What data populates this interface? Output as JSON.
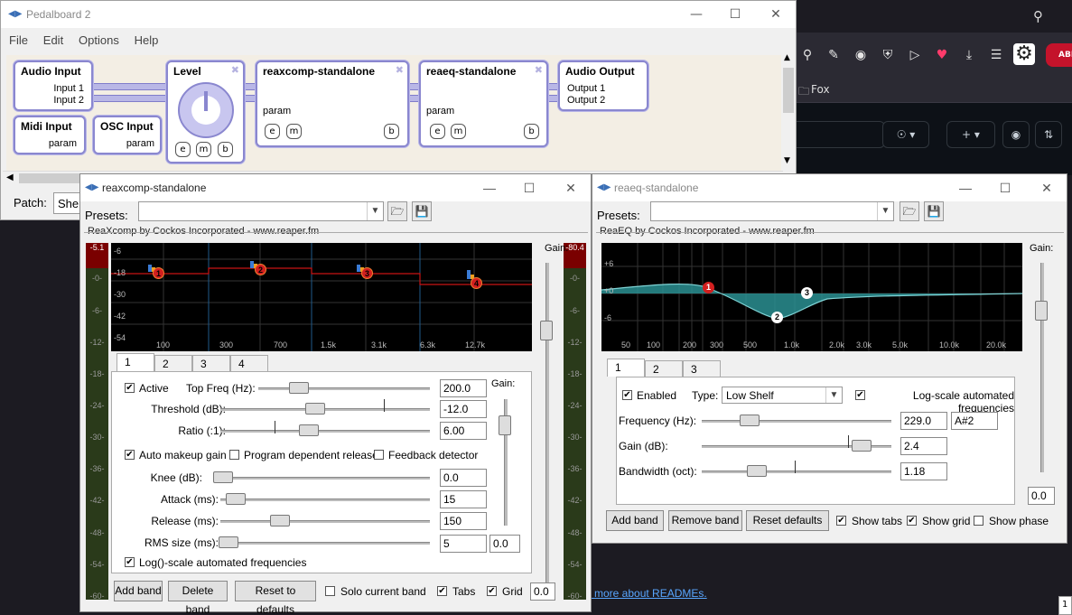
{
  "browser": {
    "bookmark_folder": "Fox",
    "readme_link": "n more about READMEs.",
    "badge_text": "ABI",
    "corner_text": "1"
  },
  "pedalboard": {
    "title": "Pedalboard 2",
    "menu": [
      "File",
      "Edit",
      "Options",
      "Help"
    ],
    "patch_label": "Patch:",
    "patch_value": "She",
    "blocks": {
      "audio_input": {
        "title": "Audio Input",
        "ports": [
          "Input 1",
          "Input 2"
        ]
      },
      "midi_input": {
        "title": "Midi Input",
        "port": "param"
      },
      "osc_input": {
        "title": "OSC Input",
        "port": "param"
      },
      "level": {
        "title": "Level",
        "btns": [
          "e",
          "m",
          "b"
        ]
      },
      "reaxcomp": {
        "title": "reaxcomp-standalone",
        "port": "param",
        "btns": [
          "e",
          "m",
          "b"
        ]
      },
      "reaeq": {
        "title": "reaeq-standalone",
        "port": "param",
        "btns": [
          "e",
          "m",
          "b"
        ]
      },
      "audio_output": {
        "title": "Audio Output",
        "ports": [
          "Output 1",
          "Output 2"
        ]
      }
    }
  },
  "reaxcomp": {
    "title": "reaxcomp-standalone",
    "presets_label": "Presets:",
    "vendor": "ReaXcomp by Cockos Incorporated - www.reaper.fm",
    "gain_label": "Gain:",
    "meter_left_top": "-5.1",
    "meter_right_top": "-80.4",
    "meter_ticks": [
      "-0-",
      "-6-",
      "-12-",
      "-18-",
      "-24-",
      "-30-",
      "-36-",
      "-42-",
      "-48-",
      "-54-",
      "-60-"
    ],
    "graph_y_labels": [
      "-6",
      "-18",
      "-30",
      "-42",
      "-54"
    ],
    "graph_x_labels": [
      "100",
      "300",
      "700",
      "1.5k",
      "3.1k",
      "6.3k",
      "12.7k"
    ],
    "band_nodes": [
      "1",
      "2",
      "3",
      "4"
    ],
    "tabs": [
      "1",
      "2",
      "3",
      "4"
    ],
    "active_label": "Active",
    "active_checked": true,
    "top_freq_label": "Top Freq (Hz):",
    "top_freq_value": "200.0",
    "band_gain_label": "Gain:",
    "threshold_label": "Threshold (dB):",
    "threshold_value": "-12.0",
    "ratio_label": "Ratio (:1):",
    "ratio_value": "6.00",
    "auto_makeup_label": "Auto makeup gain",
    "auto_makeup_checked": true,
    "program_release_label": "Program dependent release",
    "program_release_checked": false,
    "feedback_label": "Feedback detector",
    "feedback_checked": false,
    "knee_label": "Knee (dB):",
    "knee_value": "0.0",
    "attack_label": "Attack (ms):",
    "attack_value": "15",
    "release_label": "Release (ms):",
    "release_value": "150",
    "rms_label": "RMS size (ms):",
    "rms_value": "5",
    "band_gain_value": "0.0",
    "log_label": "Log()-scale automated frequencies",
    "log_checked": true,
    "add_band": "Add band",
    "delete_band": "Delete band",
    "reset_defaults": "Reset to defaults",
    "solo_label": "Solo current band",
    "solo_checked": false,
    "tabs_label": "Tabs",
    "tabs_checked": true,
    "grid_label": "Grid",
    "grid_checked": true,
    "out_gain_value": "0.0"
  },
  "reaeq": {
    "title": "reaeq-standalone",
    "presets_label": "Presets:",
    "vendor": "ReaEQ by Cockos Incorporated - www.reaper.fm",
    "gain_label": "Gain:",
    "graph_y_labels": [
      "+6",
      "+0",
      "-6"
    ],
    "graph_x_labels": [
      "50",
      "100",
      "200",
      "300",
      "500",
      "1.0k",
      "2.0k",
      "3.0k",
      "5.0k",
      "10.0k",
      "20.0k"
    ],
    "band_nodes": [
      "1",
      "2",
      "3"
    ],
    "tabs": [
      "1",
      "2",
      "3"
    ],
    "enabled_label": "Enabled",
    "enabled_checked": true,
    "type_label": "Type:",
    "type_value": "Low Shelf",
    "log_label": "Log-scale automated frequencies",
    "log_checked": true,
    "freq_label": "Frequency (Hz):",
    "freq_value": "229.0",
    "note_value": "A#2",
    "gain_db_label": "Gain (dB):",
    "gain_db_value": "2.4",
    "bandwidth_label": "Bandwidth (oct):",
    "bandwidth_value": "1.18",
    "out_gain_value": "0.0",
    "add_band": "Add band",
    "remove_band": "Remove band",
    "reset_defaults": "Reset defaults",
    "show_tabs_label": "Show tabs",
    "show_tabs_checked": true,
    "show_grid_label": "Show grid",
    "show_grid_checked": true,
    "show_phase_label": "Show phase",
    "show_phase_checked": false
  }
}
